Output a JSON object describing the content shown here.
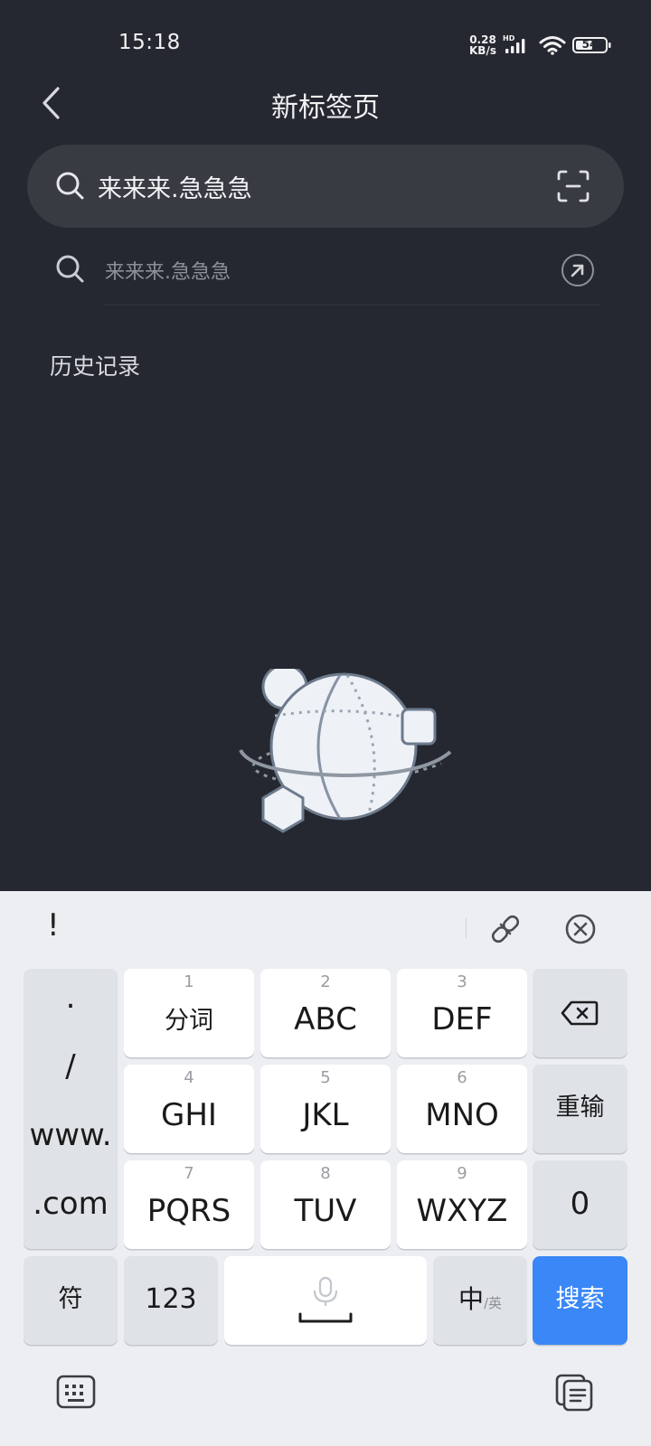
{
  "status_bar": {
    "time": "15:18",
    "net_speed_value": "0.28",
    "net_speed_unit": "KB/s",
    "network_label": "HD",
    "battery": "54"
  },
  "header": {
    "title": "新标签页"
  },
  "search": {
    "value": "来来来.急急急",
    "suggestion": "来来来.急急急"
  },
  "history": {
    "title": "历史记录"
  },
  "keyboard": {
    "toolbar_symbol": "!",
    "symbols": [
      ".",
      "/",
      "www.",
      ".com"
    ],
    "row1": [
      {
        "num": "1",
        "label": "分词"
      },
      {
        "num": "2",
        "label": "ABC"
      },
      {
        "num": "3",
        "label": "DEF"
      }
    ],
    "row2": [
      {
        "num": "4",
        "label": "GHI"
      },
      {
        "num": "5",
        "label": "JKL"
      },
      {
        "num": "6",
        "label": "MNO"
      }
    ],
    "row3": [
      {
        "num": "7",
        "label": "PQRS"
      },
      {
        "num": "8",
        "label": "TUV"
      },
      {
        "num": "9",
        "label": "WXYZ"
      }
    ],
    "reinput": "重输",
    "zero": "0",
    "symbol_key": "符",
    "num_key": "123",
    "lang_main": "中",
    "lang_sub": "/英",
    "search_key": "搜索"
  },
  "colors": {
    "background": "#252830",
    "search_box": "#383b42",
    "keyboard_bg": "#eceef2",
    "accent": "#3a87f7"
  },
  "icons": [
    "back-icon",
    "search-icon",
    "scan-icon",
    "arrow-up-left-icon",
    "link-icon",
    "close-circle-icon",
    "backspace-icon",
    "mic-icon",
    "keyboard-icon",
    "clipboard-icon"
  ]
}
